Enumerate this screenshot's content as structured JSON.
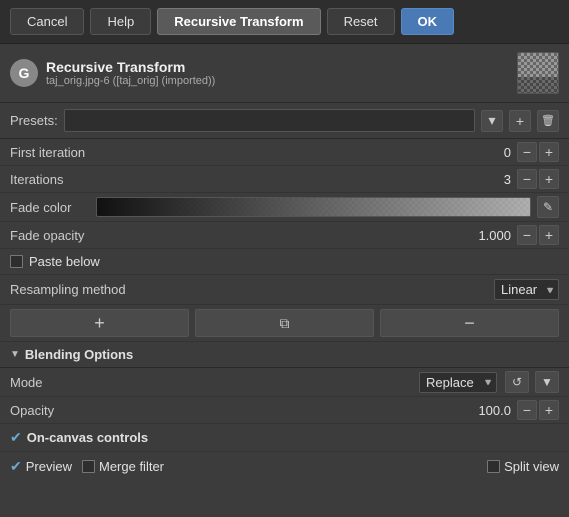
{
  "toolbar": {
    "cancel_label": "Cancel",
    "help_label": "Help",
    "title_label": "Recursive Transform",
    "reset_label": "Reset",
    "ok_label": "OK"
  },
  "header": {
    "icon_letter": "G",
    "title": "Recursive Transform",
    "subtitle": "taj_orig.jpg-6 ([taj_orig] (imported))"
  },
  "presets": {
    "label": "Presets:",
    "placeholder": "",
    "add_label": "+",
    "remove_label": "✕"
  },
  "fields": {
    "first_iteration": {
      "label": "First iteration",
      "value": "0"
    },
    "iterations": {
      "label": "Iterations",
      "value": "3"
    },
    "fade_color": {
      "label": "Fade color"
    },
    "fade_opacity": {
      "label": "Fade opacity",
      "value": "1.000"
    },
    "paste_below": {
      "label": "Paste below"
    },
    "resampling_method": {
      "label": "Resampling method",
      "value": "Linear"
    }
  },
  "blending": {
    "section_label": "Blending Options",
    "mode": {
      "label": "Mode",
      "value": "Replace"
    },
    "opacity": {
      "label": "Opacity",
      "value": "100.0"
    }
  },
  "oncanvas": {
    "label": "On-canvas controls"
  },
  "preview": {
    "label": "Preview",
    "merge_filter_label": "Merge filter",
    "split_view_label": "Split view"
  },
  "icons": {
    "minus": "−",
    "plus": "+",
    "dropdown": "▼",
    "edit": "✎",
    "reset": "↺",
    "copy": "⧉",
    "section_arrow": "▼",
    "checkmark": "✔"
  }
}
